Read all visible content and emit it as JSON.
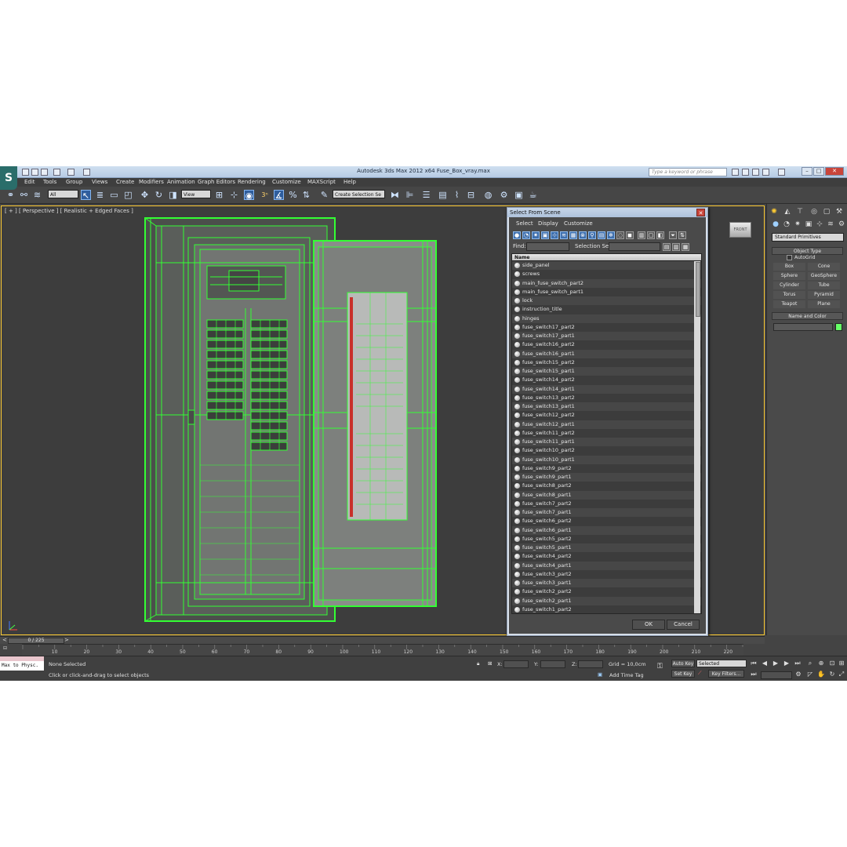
{
  "window": {
    "app_logo": "S",
    "title": "Autodesk 3ds Max  2012 x64     Fuse_Box_vray.max",
    "search_placeholder": "Type a keyword or phrase",
    "minimize": "–",
    "maximize": "□",
    "close": "✕"
  },
  "menu": [
    "Edit",
    "Tools",
    "Group",
    "Views",
    "Create",
    "Modifiers",
    "Animation",
    "Graph Editors",
    "Rendering",
    "Customize",
    "MAXScript",
    "Help"
  ],
  "toolbar": {
    "selection_filter": "All",
    "ref_coord": "View",
    "named_selection": "Create Selection Se",
    "snap_label": "3"
  },
  "viewport": {
    "label": "[ + ] [ Perspective ] [ Realistic + Edged Faces ]",
    "viewcube_label": "FRONT"
  },
  "command_panel": {
    "category": "Standard Primitives",
    "object_type_header": "Object Type",
    "autogrid_label": "AutoGrid",
    "primitives": [
      "Box",
      "Cone",
      "Sphere",
      "GeoSphere",
      "Cylinder",
      "Tube",
      "Torus",
      "Pyramid",
      "Teapot",
      "Plane"
    ],
    "name_color_header": "Name and Color",
    "object_color": "#66ff66"
  },
  "dialog": {
    "title": "Select From Scene",
    "close": "✕",
    "menu": [
      "Select",
      "Display",
      "Customize"
    ],
    "find_label": "Find:",
    "selection_set_label": "Selection Set:",
    "column_name": "Name",
    "items": [
      "side_panel",
      "screws",
      "main_fuse_switch_part2",
      "main_fuse_switch_part1",
      "lock",
      "instruction_title",
      "hinges",
      "fuse_switch17_part2",
      "fuse_switch17_part1",
      "fuse_switch16_part2",
      "fuse_switch16_part1",
      "fuse_switch15_part2",
      "fuse_switch15_part1",
      "fuse_switch14_part2",
      "fuse_switch14_part1",
      "fuse_switch13_part2",
      "fuse_switch13_part1",
      "fuse_switch12_part2",
      "fuse_switch12_part1",
      "fuse_switch11_part2",
      "fuse_switch11_part1",
      "fuse_switch10_part2",
      "fuse_switch10_part1",
      "fuse_switch9_part2",
      "fuse_switch9_part1",
      "fuse_switch8_part2",
      "fuse_switch8_part1",
      "fuse_switch7_part2",
      "fuse_switch7_part1",
      "fuse_switch6_part2",
      "fuse_switch6_part1",
      "fuse_switch5_part2",
      "fuse_switch5_part1",
      "fuse_switch4_part2",
      "fuse_switch4_part1",
      "fuse_switch3_part2",
      "fuse_switch3_part1",
      "fuse_switch2_part2",
      "fuse_switch2_part1",
      "fuse_switch1_part2"
    ],
    "ok_label": "OK",
    "cancel_label": "Cancel"
  },
  "timeline": {
    "slider_label": "0 / 225",
    "prev": "<",
    "next": ">",
    "ticks": [
      "10",
      "20",
      "30",
      "40",
      "50",
      "60",
      "70",
      "80",
      "90",
      "100",
      "110",
      "120",
      "130",
      "140",
      "150",
      "160",
      "170",
      "180",
      "190",
      "200",
      "210",
      "220"
    ]
  },
  "status": {
    "maxscript_text": "Max to Physc.",
    "selection_info": "None Selected",
    "prompt": "Click or click-and-drag to select objects",
    "x_label": "X:",
    "y_label": "Y:",
    "z_label": "Z:",
    "grid": "Grid = 10,0cm",
    "add_time_tag": "Add Time Tag",
    "auto_key": "Auto Key",
    "set_key": "Set Key",
    "key_mode": "Selected",
    "key_filters": "Key Filters..."
  },
  "colors": {
    "wireframe": "#33ff33",
    "viewport_border": "#ffcc33",
    "dialog_frame": "#d7dfe9"
  }
}
